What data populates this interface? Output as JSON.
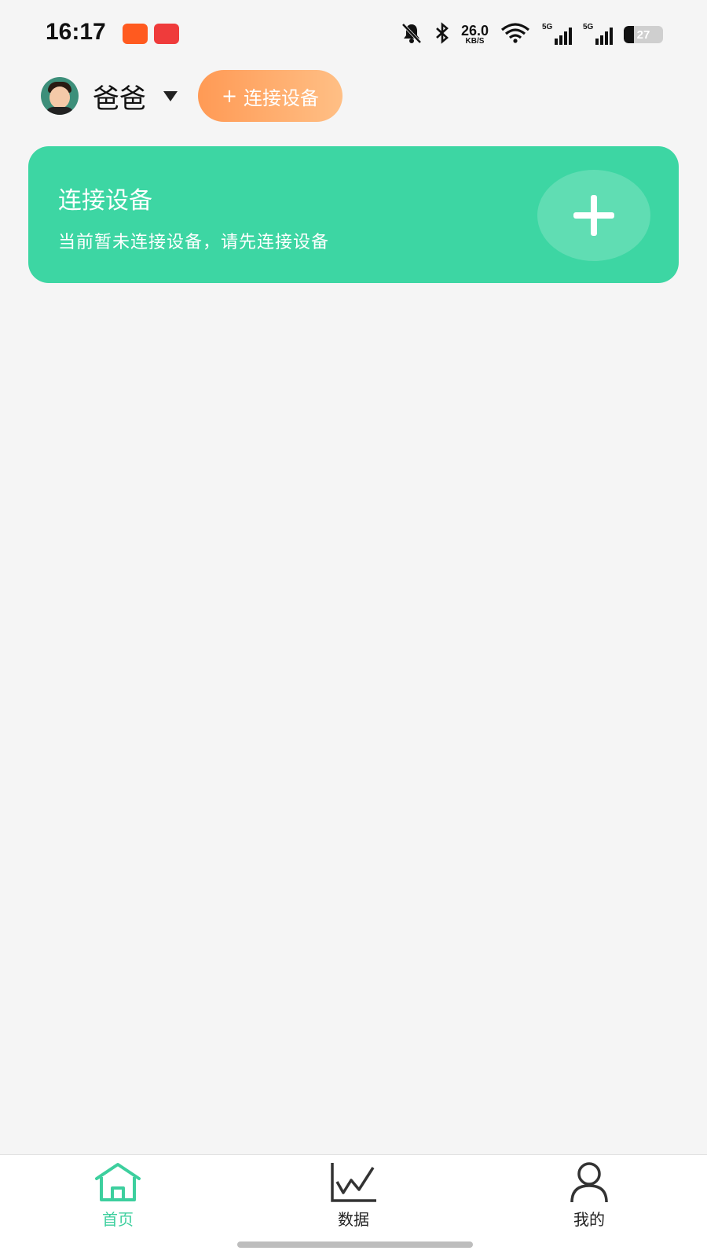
{
  "status_bar": {
    "time": "16:17",
    "net_speed_value": "26.0",
    "net_speed_unit": "KB/S",
    "signal1_label": "5G",
    "signal2_label": "5G",
    "battery": "27"
  },
  "header": {
    "user_name": "爸爸",
    "connect_button_label": "连接设备",
    "connect_button_icon": "+"
  },
  "card": {
    "title": "连接设备",
    "subtitle": "当前暂未连接设备，请先连接设备",
    "color": "#3dd6a3"
  },
  "bottom_nav": {
    "items": [
      {
        "label": "首页",
        "icon": "home-icon",
        "active": true
      },
      {
        "label": "数据",
        "icon": "chart-icon",
        "active": false
      },
      {
        "label": "我的",
        "icon": "user-icon",
        "active": false
      }
    ],
    "active_color": "#3dcf9e"
  },
  "colors": {
    "accent_green": "#3dd6a3",
    "button_orange": "#ff9a55",
    "background": "#f5f5f5"
  }
}
